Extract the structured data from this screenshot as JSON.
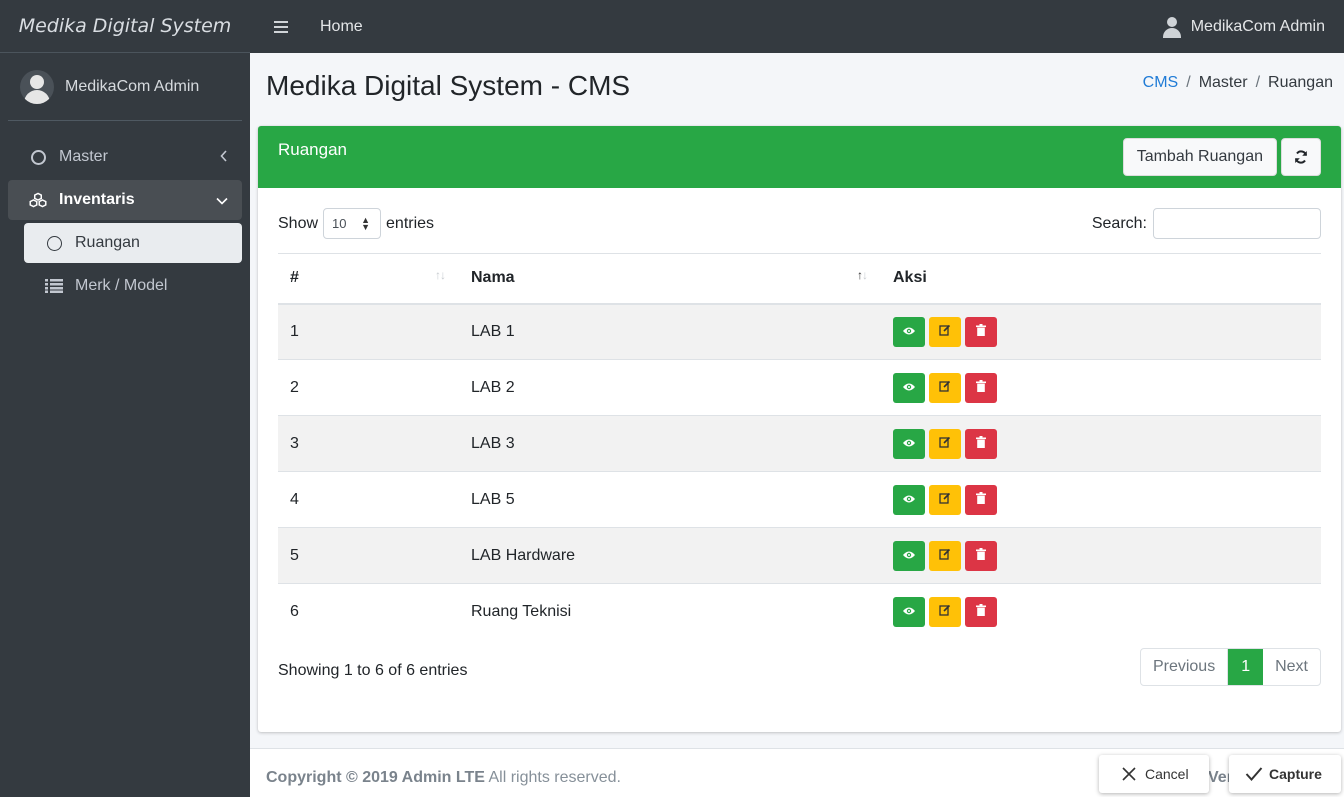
{
  "sidebar": {
    "brand": "Medika Digital System",
    "user": "MedikaCom Admin",
    "items": [
      {
        "label": "Master"
      },
      {
        "label": "Inventaris"
      }
    ],
    "sub_items": [
      {
        "label": "Ruangan"
      },
      {
        "label": "Merk / Model"
      }
    ]
  },
  "header": {
    "home": "Home",
    "user": "MedikaCom Admin"
  },
  "page": {
    "title": "Medika Digital System - CMS",
    "breadcrumb": [
      "CMS",
      "Master",
      "Ruangan"
    ]
  },
  "card": {
    "title": "Ruangan",
    "add_button": "Tambah Ruangan",
    "show_label": "Show",
    "entries_label": "entries",
    "page_length": "10",
    "search_label": "Search:",
    "search_value": "",
    "columns": [
      "#",
      "Nama",
      "Aksi"
    ],
    "rows": [
      {
        "no": "1",
        "nama": "LAB 1"
      },
      {
        "no": "2",
        "nama": "LAB 2"
      },
      {
        "no": "3",
        "nama": "LAB 3"
      },
      {
        "no": "4",
        "nama": "LAB 5"
      },
      {
        "no": "5",
        "nama": "LAB Hardware"
      },
      {
        "no": "6",
        "nama": "Ruang Teknisi"
      }
    ],
    "info": "Showing 1 to 6 of 6 entries",
    "pagination": {
      "previous": "Previous",
      "current": "1",
      "next": "Next"
    }
  },
  "footer": {
    "copyright_bold": "Copyright © 2019 Admin LTE",
    "copyright_rest": " All rights reserved.",
    "version": "Ver"
  },
  "overlay": {
    "cancel": "Cancel",
    "capture": "Capture"
  },
  "colors": {
    "sidebar": "#343a40",
    "success": "#28a745",
    "warning": "#ffc107",
    "danger": "#dc3545",
    "link": "#1f7bd6"
  },
  "icons": {
    "view": "eye-icon",
    "edit": "edit-icon",
    "delete": "trash-icon",
    "refresh": "refresh-icon"
  }
}
